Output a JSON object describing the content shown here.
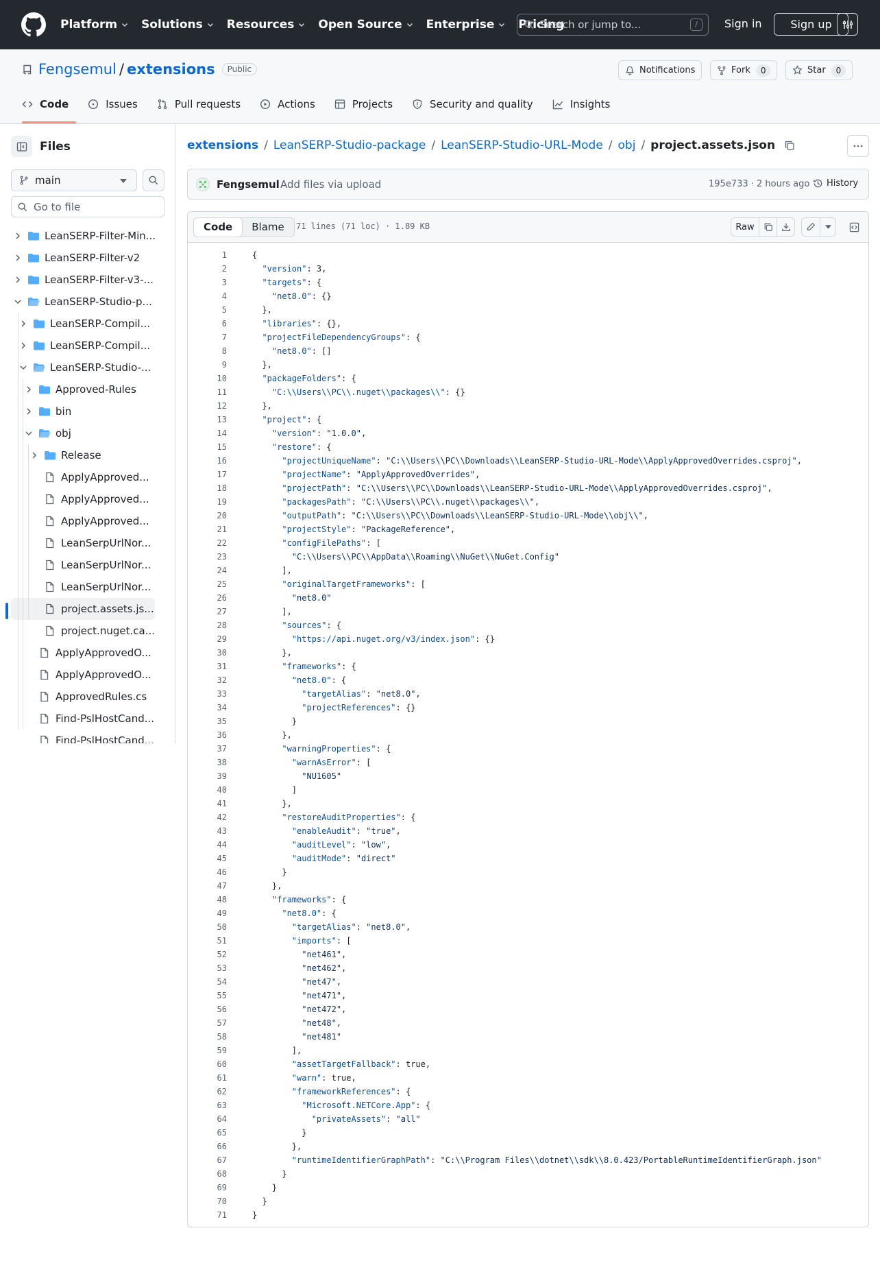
{
  "header": {
    "nav": [
      {
        "label": "Platform",
        "dropdown": true
      },
      {
        "label": "Solutions",
        "dropdown": true
      },
      {
        "label": "Resources",
        "dropdown": true
      },
      {
        "label": "Open Source",
        "dropdown": true
      },
      {
        "label": "Enterprise",
        "dropdown": true
      },
      {
        "label": "Pricing",
        "dropdown": false
      }
    ],
    "search_placeholder": "Search or jump to...",
    "search_kbd": "/",
    "sign_in": "Sign in",
    "sign_up": "Sign up"
  },
  "repo": {
    "owner": "Fengsemul",
    "slash": "/",
    "name": "extensions",
    "visibility": "Public",
    "notifications": "Notifications",
    "fork_label": "Fork",
    "fork_count": "0",
    "star_label": "Star",
    "star_count": "0",
    "tabs": [
      {
        "label": "Code",
        "icon": "code-icon",
        "active": true
      },
      {
        "label": "Issues",
        "icon": "issue-icon"
      },
      {
        "label": "Pull requests",
        "icon": "pull-request-icon"
      },
      {
        "label": "Actions",
        "icon": "play-icon"
      },
      {
        "label": "Projects",
        "icon": "table-icon"
      },
      {
        "label": "Security and quality",
        "icon": "shield-icon"
      },
      {
        "label": "Insights",
        "icon": "graph-icon"
      }
    ]
  },
  "sidebar": {
    "title": "Files",
    "branch": "main",
    "goto_placeholder": "Go to file",
    "tree": [
      {
        "label": "LeanSERP-Filter-Min...",
        "type": "folder",
        "depth": 0,
        "expanded": false
      },
      {
        "label": "LeanSERP-Filter-v2",
        "type": "folder",
        "depth": 0,
        "expanded": false
      },
      {
        "label": "LeanSERP-Filter-v3-...",
        "type": "folder",
        "depth": 0,
        "expanded": false
      },
      {
        "label": "LeanSERP-Studio-p...",
        "type": "folder",
        "depth": 0,
        "expanded": true
      },
      {
        "label": "LeanSERP-Compil...",
        "type": "folder",
        "depth": 1,
        "expanded": false
      },
      {
        "label": "LeanSERP-Compil...",
        "type": "folder",
        "depth": 1,
        "expanded": false
      },
      {
        "label": "LeanSERP-Studio-...",
        "type": "folder",
        "depth": 1,
        "expanded": true
      },
      {
        "label": "Approved-Rules",
        "type": "folder",
        "depth": 2,
        "expanded": false
      },
      {
        "label": "bin",
        "type": "folder",
        "depth": 2,
        "expanded": false
      },
      {
        "label": "obj",
        "type": "folder",
        "depth": 2,
        "expanded": true
      },
      {
        "label": "Release",
        "type": "folder",
        "depth": 3,
        "expanded": false
      },
      {
        "label": "ApplyApproved...",
        "type": "file",
        "depth": 3
      },
      {
        "label": "ApplyApproved...",
        "type": "file",
        "depth": 3
      },
      {
        "label": "ApplyApproved...",
        "type": "file",
        "depth": 3
      },
      {
        "label": "LeanSerpUrlNor...",
        "type": "file",
        "depth": 3
      },
      {
        "label": "LeanSerpUrlNor...",
        "type": "file",
        "depth": 3
      },
      {
        "label": "LeanSerpUrlNor...",
        "type": "file",
        "depth": 3
      },
      {
        "label": "project.assets.js...",
        "type": "file",
        "depth": 3,
        "selected": true
      },
      {
        "label": "project.nuget.ca...",
        "type": "file",
        "depth": 3
      },
      {
        "label": "ApplyApprovedO...",
        "type": "file",
        "depth": 2
      },
      {
        "label": "ApplyApprovedO...",
        "type": "file",
        "depth": 2
      },
      {
        "label": "ApprovedRules.cs",
        "type": "file",
        "depth": 2
      },
      {
        "label": "Find-PslHostCand...",
        "type": "file",
        "depth": 2
      },
      {
        "label": "Find-PslHostCand...",
        "type": "file",
        "depth": 2
      }
    ]
  },
  "breadcrumb": {
    "items": [
      "extensions",
      "LeanSERP-Studio-package",
      "LeanSERP-Studio-URL-Mode",
      "obj"
    ],
    "current": "project.assets.json",
    "separator": "/"
  },
  "commit": {
    "author": "Fengsemul",
    "message": "Add files via upload",
    "meta": "195e733 · 2 hours ago",
    "history": "History"
  },
  "file": {
    "tab_code": "Code",
    "tab_blame": "Blame",
    "info": "71 lines (71 loc) · 1.89 KB",
    "raw": "Raw",
    "lines": [
      "{",
      "  \"version\": 3,",
      "  \"targets\": {",
      "    \"net8.0\": {}",
      "  },",
      "  \"libraries\": {},",
      "  \"projectFileDependencyGroups\": {",
      "    \"net8.0\": []",
      "  },",
      "  \"packageFolders\": {",
      "    \"C:\\\\Users\\\\PC\\\\.nuget\\\\packages\\\\\": {}",
      "  },",
      "  \"project\": {",
      "    \"version\": \"1.0.0\",",
      "    \"restore\": {",
      "      \"projectUniqueName\": \"C:\\\\Users\\\\PC\\\\Downloads\\\\LeanSERP-Studio-URL-Mode\\\\ApplyApprovedOverrides.csproj\",",
      "      \"projectName\": \"ApplyApprovedOverrides\",",
      "      \"projectPath\": \"C:\\\\Users\\\\PC\\\\Downloads\\\\LeanSERP-Studio-URL-Mode\\\\ApplyApprovedOverrides.csproj\",",
      "      \"packagesPath\": \"C:\\\\Users\\\\PC\\\\.nuget\\\\packages\\\\\",",
      "      \"outputPath\": \"C:\\\\Users\\\\PC\\\\Downloads\\\\LeanSERP-Studio-URL-Mode\\\\obj\\\\\",",
      "      \"projectStyle\": \"PackageReference\",",
      "      \"configFilePaths\": [",
      "        \"C:\\\\Users\\\\PC\\\\AppData\\\\Roaming\\\\NuGet\\\\NuGet.Config\"",
      "      ],",
      "      \"originalTargetFrameworks\": [",
      "        \"net8.0\"",
      "      ],",
      "      \"sources\": {",
      "        \"https://api.nuget.org/v3/index.json\": {}",
      "      },",
      "      \"frameworks\": {",
      "        \"net8.0\": {",
      "          \"targetAlias\": \"net8.0\",",
      "          \"projectReferences\": {}",
      "        }",
      "      },",
      "      \"warningProperties\": {",
      "        \"warnAsError\": [",
      "          \"NU1605\"",
      "        ]",
      "      },",
      "      \"restoreAuditProperties\": {",
      "        \"enableAudit\": \"true\",",
      "        \"auditLevel\": \"low\",",
      "        \"auditMode\": \"direct\"",
      "      }",
      "    },",
      "    \"frameworks\": {",
      "      \"net8.0\": {",
      "        \"targetAlias\": \"net8.0\",",
      "        \"imports\": [",
      "          \"net461\",",
      "          \"net462\",",
      "          \"net47\",",
      "          \"net471\",",
      "          \"net472\",",
      "          \"net48\",",
      "          \"net481\"",
      "        ],",
      "        \"assetTargetFallback\": true,",
      "        \"warn\": true,",
      "        \"frameworkReferences\": {",
      "          \"Microsoft.NETCore.App\": {",
      "            \"privateAssets\": \"all\"",
      "          }",
      "        },",
      "        \"runtimeIdentifierGraphPath\": \"C:\\\\Program Files\\\\dotnet\\\\sdk\\\\8.0.423/PortableRuntimeIdentifierGraph.json\"",
      "      }",
      "    }",
      "  }",
      "}"
    ]
  },
  "colors": {
    "header_bg": "#24292f",
    "link": "#0969da",
    "active_tab_underline": "#fd8c73",
    "json_key": "#0550ae",
    "json_string": "#0a3069",
    "folder": "#54aeff"
  }
}
